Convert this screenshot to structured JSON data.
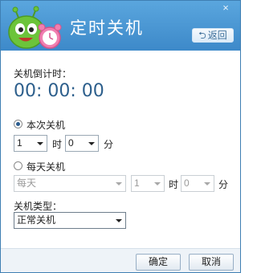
{
  "window": {
    "title": "定时关机",
    "close_label": "×",
    "back_label": "返回",
    "back_glyph": "⮌"
  },
  "countdown": {
    "label": "关机倒计时：",
    "value": "00: 00: 00"
  },
  "once": {
    "label": "本次关机",
    "checked": true,
    "hour_value": "1",
    "hour_unit": "时",
    "minute_value": "0",
    "minute_unit": "分"
  },
  "daily": {
    "label": "每天关机",
    "checked": false,
    "day_value": "每天",
    "hour_value": "1",
    "hour_unit": "时",
    "minute_value": "0",
    "minute_unit": "分"
  },
  "shutdown_type": {
    "label": "关机类型：",
    "value": "正常关机"
  },
  "buttons": {
    "ok": "确定",
    "cancel": "取消"
  },
  "colors": {
    "titlebar": "#4a97d4",
    "countdown": "#2d5f8c",
    "mascot_green": "#6cc43a",
    "clock_pink": "#f07fb0"
  }
}
